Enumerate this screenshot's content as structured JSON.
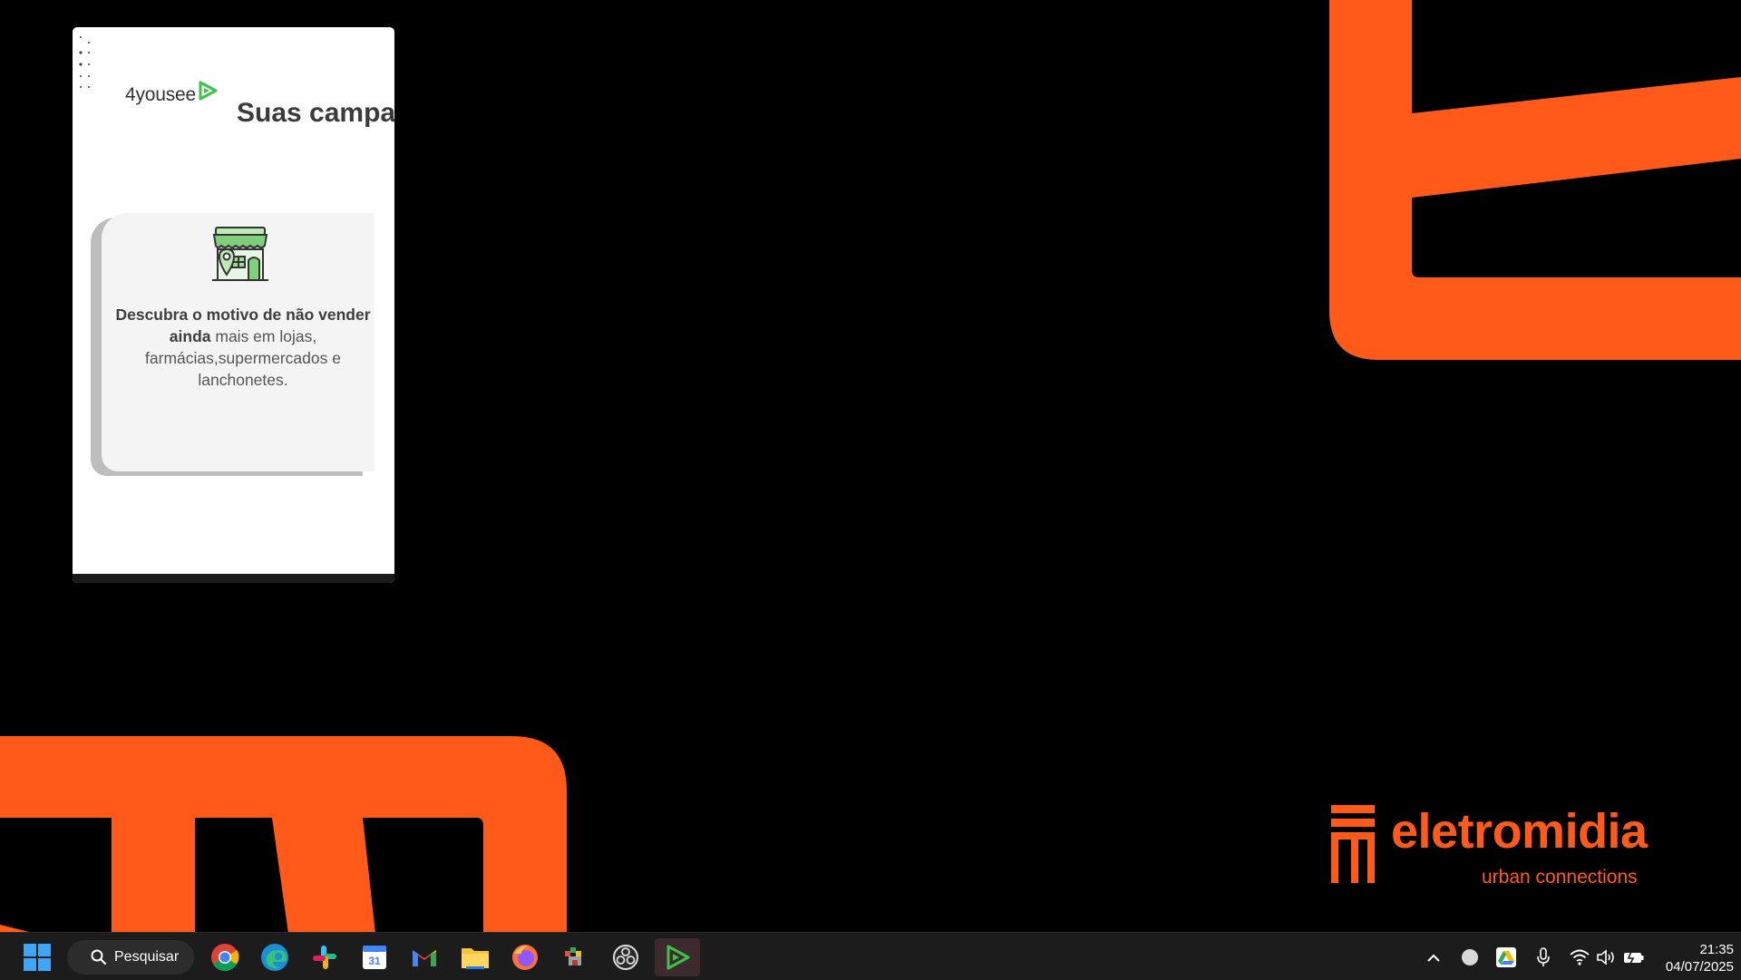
{
  "window": {
    "logo_text": "4yousee",
    "page_title": "Suas campa"
  },
  "card": {
    "bold_text": "Descubra o motivo de não vender ainda",
    "regular_text": " mais em lojas, farmácias,supermercados e lanchonetes."
  },
  "wallpaper": {
    "brand_name": "eletromidia",
    "brand_tagline": "urban connections",
    "accent_color": "#ff5a1a"
  },
  "taskbar": {
    "search_label": "Pesquisar",
    "apps": [
      "start-icon",
      "chrome-icon",
      "edge-icon",
      "slack-icon",
      "calendar-icon",
      "gmail-icon",
      "file-explorer-icon",
      "firefox-icon",
      "pixel-app-icon",
      "obs-icon",
      "play-app-icon"
    ],
    "calendar_day": "31",
    "time": "21:35",
    "date": "04/07/2025"
  }
}
